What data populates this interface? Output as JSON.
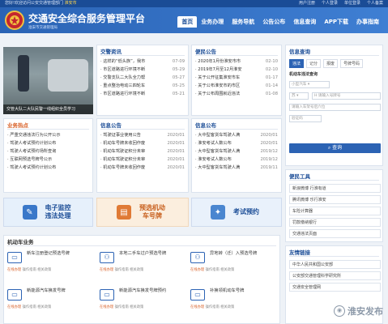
{
  "topbar": {
    "welcome": "您好!欢迎访问公安交通管理部门",
    "city": "淮安市",
    "links": [
      "用户注册",
      "个人登录",
      "单位登录",
      "个人备案"
    ]
  },
  "header": {
    "title": "交通安全综合服务管理平台",
    "subtitle": "淮安市交通管理局",
    "nav": [
      "首页",
      "业务办理",
      "服务导航",
      "公告公布",
      "信息查询",
      "APP下载",
      "办事指南"
    ]
  },
  "photo": {
    "caption": "交管大队二大队民警一线组织全员学习"
  },
  "news": {
    "title": "交警资讯",
    "more": "更多",
    "items": [
      {
        "t": "· 这样的“低头族”，我市",
        "d": "07-09"
      },
      {
        "t": "· 市区道路进行环境不断",
        "d": "05-29"
      },
      {
        "t": "· 交警支队二大队全力帮",
        "d": "05-27"
      },
      {
        "t": "· 重点整治电动三四轮车",
        "d": "05-25"
      },
      {
        "t": "· 市区道路进行环境不断",
        "d": "05-21"
      }
    ]
  },
  "bianmin": {
    "title": "便民公告",
    "more": "更多",
    "items": [
      {
        "t": "· 2020年1月份淮安市市",
        "d": "02-10"
      },
      {
        "t": "· 2019年7月至12月淮安",
        "d": "02-10"
      },
      {
        "t": "· 关于公开征集淮安市车",
        "d": "01-17"
      },
      {
        "t": "· 关于公布淮安市的市区",
        "d": "01-14"
      },
      {
        "t": "· 关于公布周围就近违法",
        "d": "01-08"
      }
    ]
  },
  "hot": {
    "title": "业务热点",
    "items": [
      "· 严重交通违法行为公开公示",
      "· 驾驶人考试预约计划公布",
      "· 驾驶人考试预约场所查询",
      "· 互联网预选号牌号公示",
      "· 驾驶人考试预约计划公布"
    ]
  },
  "info": {
    "title": "信息公告",
    "more": "更多",
    "items": [
      {
        "t": "· 驾驶证事业使用公告",
        "d": "2020/01"
      },
      {
        "t": "· 机动车号牌未收回作废",
        "d": "2020/01"
      },
      {
        "t": "· 机动车驾驶证积分未审",
        "d": "2020/01"
      },
      {
        "t": "· 机动车驾驶证积分未审",
        "d": "2020/01"
      },
      {
        "t": "· 机动车号牌未收回作废",
        "d": "2020/01"
      }
    ]
  },
  "infopub": {
    "title": "信息公布",
    "more": "更多",
    "items": [
      {
        "t": "· 大中型客货车驾驶人满",
        "d": "2020/01"
      },
      {
        "t": "· 淮安考试人数公布",
        "d": "2020/01"
      },
      {
        "t": "· 大中型客货车驾驶人满",
        "d": "2019/12"
      },
      {
        "t": "· 淮安考试人数公布",
        "d": "2019/12"
      },
      {
        "t": "· 大中型客货车驾驶人满",
        "d": "2019/11"
      }
    ]
  },
  "quick": [
    {
      "label": "电子监控\n违法处理",
      "icon": "✎"
    },
    {
      "label": "预选机动\n车号牌",
      "icon": "▤"
    },
    {
      "label": "考试预约",
      "icon": "✦"
    }
  ],
  "query": {
    "title": "信息查询",
    "tabs": [
      "违法",
      "记分",
      "报废",
      "号牌号码"
    ],
    "section": "机动车违法查询",
    "plate_type": "小型汽车",
    "province": "苏",
    "plate_placeholder": "H 请输入号牌号",
    "vin_placeholder": "请输入车架号后六位",
    "captcha_placeholder": "验证码",
    "button": "查询"
  },
  "tools": {
    "title": "便民工具",
    "items": [
      "新浪微博 行淮有道",
      "腾讯微博 乐行淮安",
      "车险计算器",
      "罚款缴纳银行",
      "交通违法页面"
    ]
  },
  "links": {
    "title": "友情链接",
    "items": [
      "中华人民共和国公安部",
      "公安部交通管理科学研究所",
      "交通安全管理网"
    ]
  },
  "business": {
    "title": "机动车业务",
    "ops": [
      "在线办理",
      "操作指南",
      "相关政策"
    ],
    "items": [
      {
        "name": "新车注册登记预选号牌",
        "icon": "▭"
      },
      {
        "name": "本地二手车过户预选号牌",
        "icon": "⚇"
      },
      {
        "name": "异地转（迁）入预选号牌",
        "icon": "⚇"
      },
      {
        "name": "新能源汽车换发号牌",
        "icon": "▭"
      },
      {
        "name": "新能源汽车换发号牌预约",
        "icon": "▭"
      },
      {
        "name": "补换领机动车号牌",
        "icon": "▭"
      }
    ]
  },
  "watermark": "淮安发布"
}
